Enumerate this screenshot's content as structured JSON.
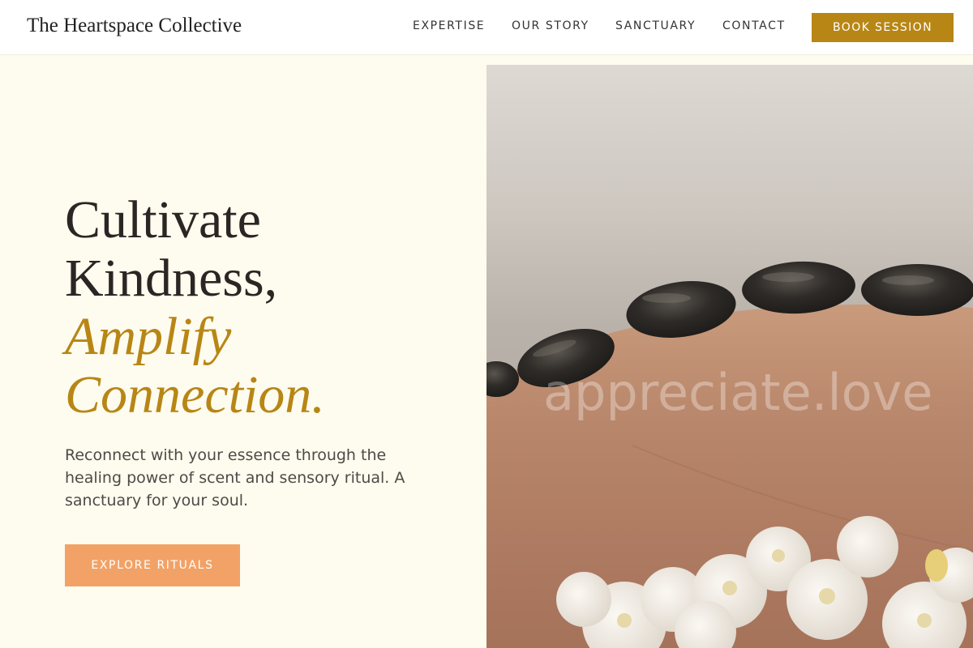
{
  "header": {
    "logo": "The Heartspace Collective",
    "nav": [
      {
        "label": "EXPERTISE"
      },
      {
        "label": "OUR STORY"
      },
      {
        "label": "SANCTUARY"
      },
      {
        "label": "CONTACT"
      }
    ],
    "book_label": "BOOK SESSION"
  },
  "hero": {
    "title_line1": "Cultivate",
    "title_line2": "Kindness,",
    "title_accent1": "Amplify",
    "title_accent2": "Connection.",
    "description": "Reconnect with your essence through the healing power of scent and sensory ritual. A sanctuary for your soul.",
    "cta_label": "EXPLORE RITUALS",
    "image_watermark": "appreciate.love"
  },
  "colors": {
    "accent_gold": "#b78615",
    "cta_orange": "#f2a266",
    "background_cream": "#fefbef"
  }
}
